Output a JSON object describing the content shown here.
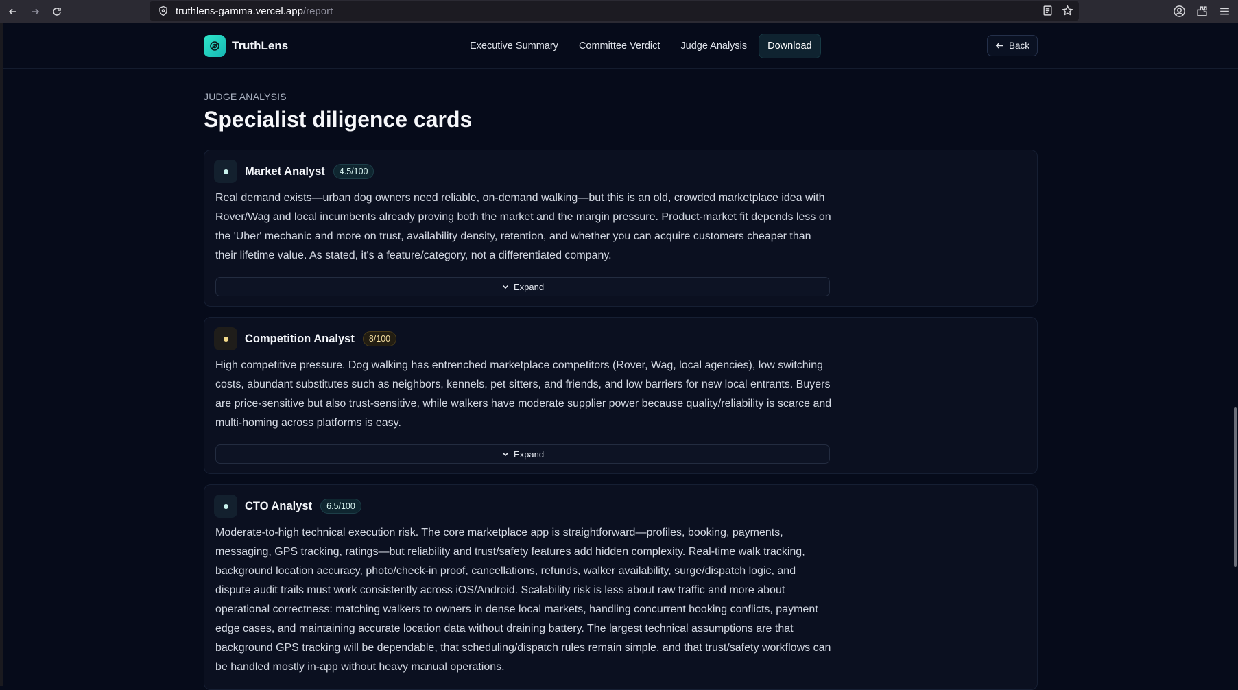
{
  "browser": {
    "url_host": "truthlens-gamma.vercel.app",
    "url_path": "/report"
  },
  "app": {
    "name": "TruthLens",
    "nav": [
      {
        "label": "Executive Summary"
      },
      {
        "label": "Committee Verdict"
      },
      {
        "label": "Judge Analysis"
      },
      {
        "label": "Download"
      }
    ],
    "back_label": "Back"
  },
  "section": {
    "label": "JUDGE ANALYSIS",
    "title": "Specialist diligence cards"
  },
  "cards": [
    {
      "title": "Market Analyst",
      "score": "4.5/100",
      "body": "Real demand exists—urban dog owners need reliable, on-demand walking—but this is an old, crowded marketplace idea with Rover/Wag and local incumbents already proving both the market and the margin pressure. Product-market fit depends less on the 'Uber' mechanic and more on trust, availability density, retention, and whether you can acquire customers cheaper than their lifetime value. As stated, it's a feature/category, not a differentiated company.",
      "expand_label": "Expand"
    },
    {
      "title": "Competition Analyst",
      "score": "8/100",
      "body": "High competitive pressure. Dog walking has entrenched marketplace competitors (Rover, Wag, local agencies), low switching costs, abundant substitutes such as neighbors, kennels, pet sitters, and friends, and low barriers for new local entrants. Buyers are price-sensitive but also trust-sensitive, while walkers have moderate supplier power because quality/reliability is scarce and multi-homing across platforms is easy.",
      "expand_label": "Expand"
    },
    {
      "title": "CTO Analyst",
      "score": "6.5/100",
      "body": "Moderate-to-high technical execution risk. The core marketplace app is straightforward—profiles, booking, payments, messaging, GPS tracking, ratings—but reliability and trust/safety features add hidden complexity. Real-time walk tracking, background location accuracy, photo/check-in proof, cancellations, refunds, walker availability, surge/dispatch logic, and dispute audit trails must work consistently across iOS/Android. Scalability risk is less about raw traffic and more about operational correctness: matching walkers to owners in dense local markets, handling concurrent booking conflicts, payment edge cases, and maintaining accurate location data without draining battery. The largest technical assumptions are that background GPS tracking will be dependable, that scheduling/dispatch rules remain simple, and that trust/safety workflows can be handled mostly in-app without heavy manual operations."
    }
  ],
  "colors": {
    "background": "#060b1a",
    "accent": "#2ee6c9",
    "amber": "#f3d98a"
  }
}
